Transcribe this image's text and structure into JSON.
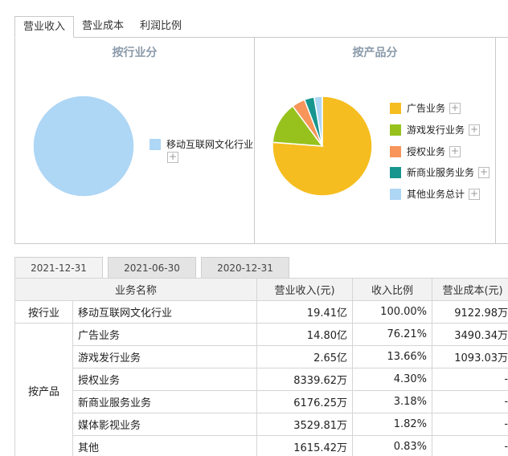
{
  "tabs": [
    {
      "label": "营业收入",
      "active": true
    },
    {
      "label": "营业成本",
      "active": false
    },
    {
      "label": "利润比例",
      "active": false
    }
  ],
  "industry_panel": {
    "title": "按行业分",
    "legend": [
      {
        "label": "移动互联网文化行业",
        "color": "#aed6f5"
      }
    ]
  },
  "product_panel": {
    "title": "按产品分",
    "legend": [
      {
        "label": "广告业务",
        "color": "#f5bd1f"
      },
      {
        "label": "游戏发行业务",
        "color": "#97c21e"
      },
      {
        "label": "授权业务",
        "color": "#f7955a"
      },
      {
        "label": "新商业服务业务",
        "color": "#16968e"
      },
      {
        "label": "其他业务总计",
        "color": "#aed6f5"
      }
    ]
  },
  "chart_data": [
    {
      "type": "pie",
      "title": "按行业分",
      "categories": [
        "移动互联网文化行业"
      ],
      "values": [
        100.0
      ]
    },
    {
      "type": "pie",
      "title": "按产品分",
      "categories": [
        "广告业务",
        "游戏发行业务",
        "授权业务",
        "新商业服务业务",
        "其他业务总计"
      ],
      "values": [
        76.21,
        13.66,
        4.3,
        3.18,
        2.65
      ]
    }
  ],
  "date_tabs": [
    {
      "label": "2021-12-31",
      "active": true
    },
    {
      "label": "2021-06-30",
      "active": false
    },
    {
      "label": "2020-12-31",
      "active": false
    }
  ],
  "table": {
    "headers": [
      "业务名称",
      "营业收入(元)",
      "收入比例",
      "营业成本(元)"
    ],
    "industry_group": "按行业",
    "product_group": "按产品",
    "industry_rows": [
      {
        "name": "移动互联网文化行业",
        "revenue": "19.41亿",
        "ratio": "100.00%",
        "cost": "9122.98万"
      }
    ],
    "product_rows": [
      {
        "name": "广告业务",
        "revenue": "14.80亿",
        "ratio": "76.21%",
        "cost": "3490.34万"
      },
      {
        "name": "游戏发行业务",
        "revenue": "2.65亿",
        "ratio": "13.66%",
        "cost": "1093.03万"
      },
      {
        "name": "授权业务",
        "revenue": "8339.62万",
        "ratio": "4.30%",
        "cost": "-"
      },
      {
        "name": "新商业服务业务",
        "revenue": "6176.25万",
        "ratio": "3.18%",
        "cost": "-"
      },
      {
        "name": "媒体影视业务",
        "revenue": "3529.81万",
        "ratio": "1.82%",
        "cost": "-"
      },
      {
        "name": "其他",
        "revenue": "1615.42万",
        "ratio": "0.83%",
        "cost": "-"
      }
    ]
  }
}
